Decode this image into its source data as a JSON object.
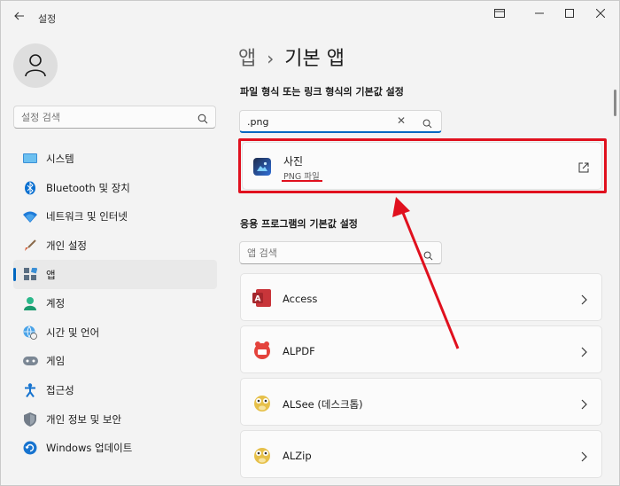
{
  "window": {
    "title": "설정",
    "back_icon": "back-arrow-icon",
    "minimize_icon": "minimize-icon",
    "maximize_icon": "maximize-icon",
    "close_icon": "close-icon",
    "extra_icon": "snap-layout-icon"
  },
  "sidebar": {
    "search_placeholder": "설정 검색",
    "items": [
      {
        "label": "시스템",
        "icon": "monitor-icon",
        "active": false
      },
      {
        "label": "Bluetooth 및 장치",
        "icon": "bluetooth-icon",
        "active": false
      },
      {
        "label": "네트워크 및 인터넷",
        "icon": "wifi-icon",
        "active": false
      },
      {
        "label": "개인 설정",
        "icon": "brush-icon",
        "active": false
      },
      {
        "label": "앱",
        "icon": "apps-icon",
        "active": true
      },
      {
        "label": "계정",
        "icon": "account-icon",
        "active": false
      },
      {
        "label": "시간 및 언어",
        "icon": "globe-clock-icon",
        "active": false
      },
      {
        "label": "게임",
        "icon": "gamepad-icon",
        "active": false
      },
      {
        "label": "접근성",
        "icon": "accessibility-icon",
        "active": false
      },
      {
        "label": "개인 정보 및 보안",
        "icon": "shield-icon",
        "active": false
      },
      {
        "label": "Windows 업데이트",
        "icon": "update-icon",
        "active": false
      }
    ]
  },
  "main": {
    "breadcrumb_root": "앱",
    "breadcrumb_separator": "›",
    "breadcrumb_current": "기본 앱",
    "file_type_section_label": "파일 형식 또는 링크 형식의 기본값 설정",
    "file_type_search_value": ".png",
    "result": {
      "name": "사진",
      "type": "PNG 파일",
      "icon": "photos-app-icon",
      "action_icon": "open-external-icon"
    },
    "apps_section_label": "응용 프로그램의 기본값 설정",
    "app_search_placeholder": "앱 검색",
    "apps": [
      {
        "name": "Access",
        "icon": "access-icon"
      },
      {
        "name": "ALPDF",
        "icon": "alpdf-icon"
      },
      {
        "name": "ALSee (데스크톱)",
        "icon": "alsee-icon"
      },
      {
        "name": "ALZip",
        "icon": "alzip-icon"
      }
    ]
  },
  "colors": {
    "accent": "#0067c0",
    "highlight": "#e0101e",
    "background": "#f3f3f3",
    "card": "#fbfbfb"
  }
}
